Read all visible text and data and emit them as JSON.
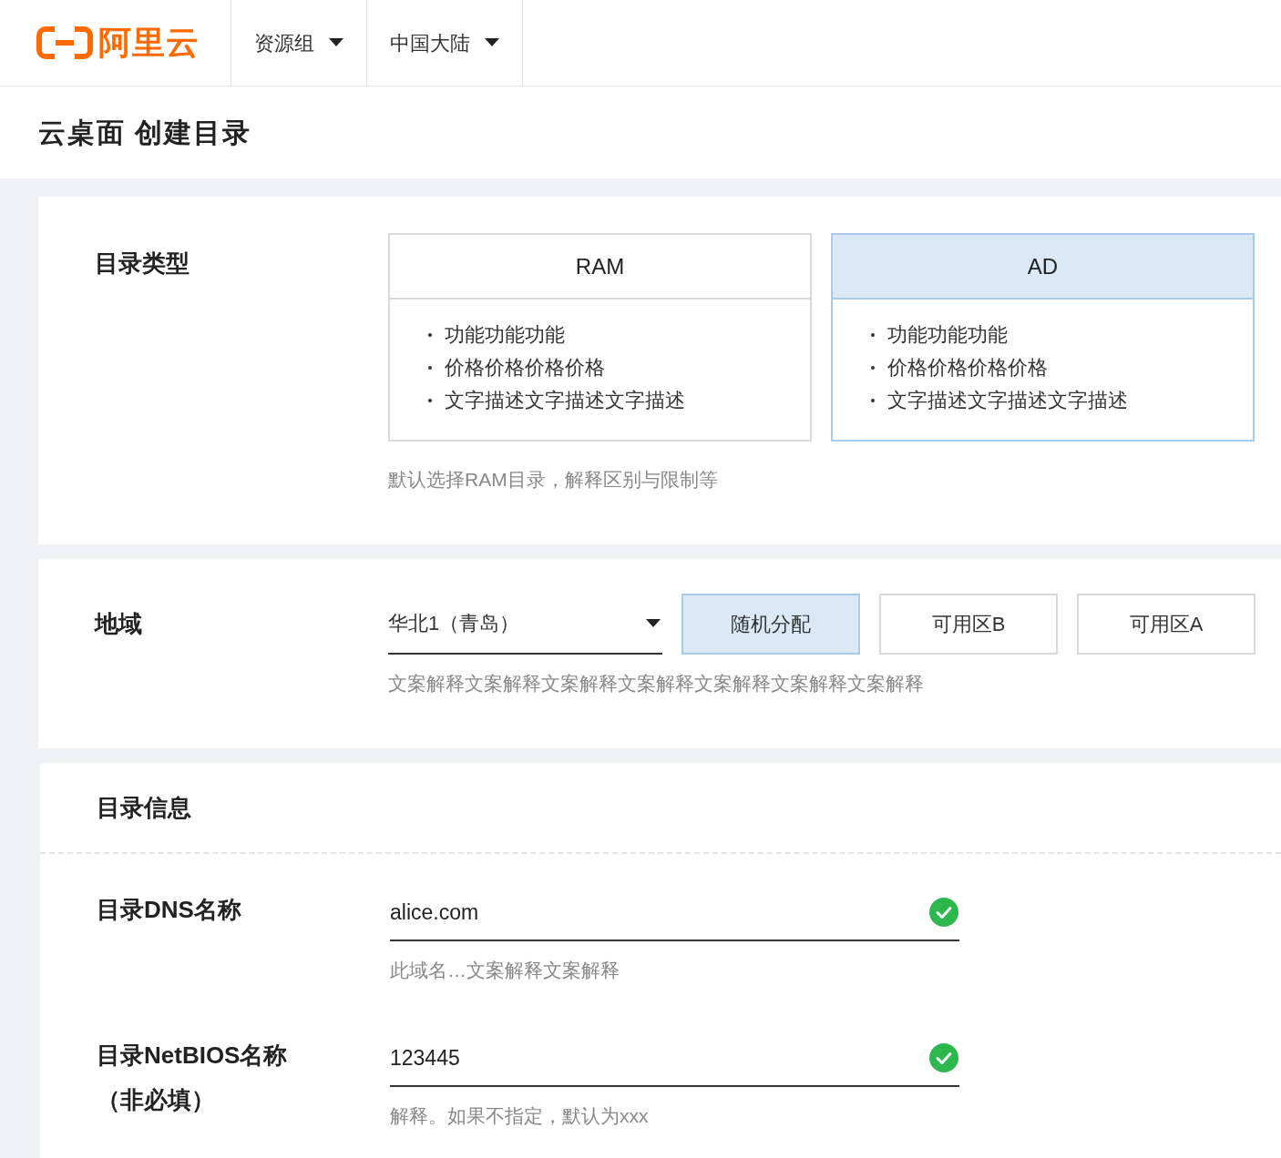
{
  "header": {
    "logo_text": "阿里云",
    "dropdowns": [
      {
        "label": "资源组"
      },
      {
        "label": "中国大陆"
      }
    ]
  },
  "page_title": "云桌面 创建目录",
  "directory_type": {
    "label": "目录类型",
    "options": [
      {
        "title": "RAM",
        "selected": false,
        "features": [
          "功能功能功能",
          "价格价格价格价格",
          "文字描述文字描述文字描述"
        ]
      },
      {
        "title": "AD",
        "selected": true,
        "features": [
          "功能功能功能",
          "价格价格价格价格",
          "文字描述文字描述文字描述"
        ]
      }
    ],
    "hint": "默认选择RAM目录，解释区别与限制等"
  },
  "region": {
    "label": "地域",
    "select_value": "华北1（青岛）",
    "zones": [
      {
        "label": "随机分配",
        "selected": true
      },
      {
        "label": "可用区B",
        "selected": false
      },
      {
        "label": "可用区A",
        "selected": false
      }
    ],
    "hint": "文案解释文案解释文案解释文案解释文案解释文案解释文案解释"
  },
  "directory_info": {
    "title": "目录信息",
    "fields": [
      {
        "label": "目录DNS名称",
        "value": "alice.com",
        "valid": true,
        "hint": "此域名…文案解释文案解释"
      },
      {
        "label": "目录NetBIOS名称",
        "note": "（非必填）",
        "value": "123445",
        "valid": true,
        "hint": "解释。如果不指定，默认为xxx"
      }
    ]
  }
}
